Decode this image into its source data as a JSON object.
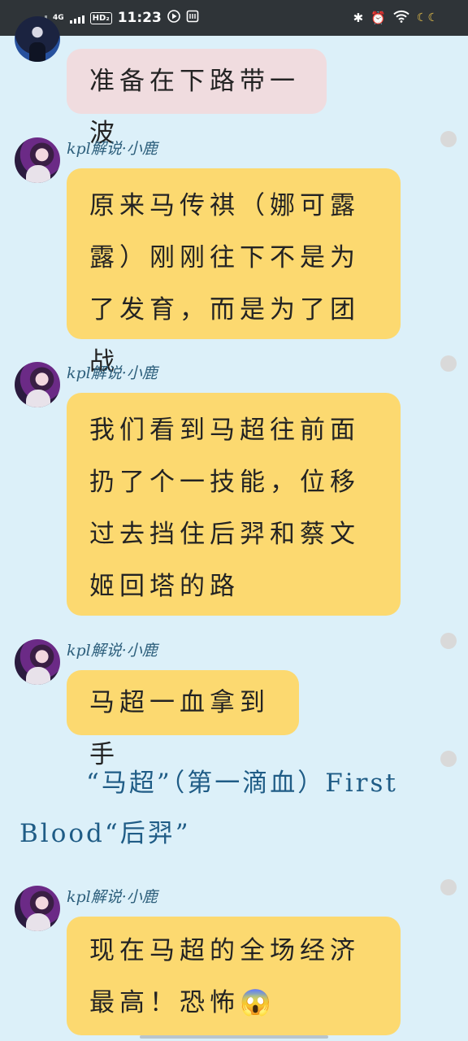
{
  "status_bar": {
    "network": "4G",
    "hd": "HD₂",
    "time": "11:23",
    "play_icon": "play-icon",
    "nfc_icon": "nfc-icon",
    "bluetooth_icon": "✱",
    "alarm_icon": "⏰",
    "wifi_icon": "wifi-icon",
    "moons": "☾☾"
  },
  "messages": [
    {
      "type": "bubble",
      "sender": "",
      "text": "准备在下路带一波",
      "color": "#f0dcdf"
    },
    {
      "type": "bubble",
      "sender": "kpl解说·小鹿",
      "text": "原来马传祺（娜可露露）刚刚往下不是为了发育，而是为了团战"
    },
    {
      "type": "bubble",
      "sender": "kpl解说·小鹿",
      "text": "我们看到马超往前面扔了个一技能，位移过去挡住后羿和蔡文姬回塔的路"
    },
    {
      "type": "bubble",
      "sender": "kpl解说·小鹿",
      "text": "马超一血拿到手"
    },
    {
      "type": "system",
      "text": "“马超”（第一滴血）First Blood“后羿”"
    },
    {
      "type": "bubble",
      "sender": "kpl解说·小鹿",
      "text": "现在马超的全场经济最高！恐怖😱"
    }
  ],
  "colors": {
    "background": "#dcf0f9",
    "bubble_yellow": "#fcd970",
    "bubble_pink": "#f0dcdf",
    "sender_text": "#2d5f7c",
    "system_text": "#1f5c86",
    "status_bar": "#2f3438"
  }
}
